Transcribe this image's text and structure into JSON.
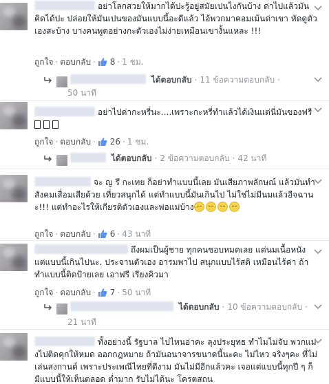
{
  "comments": [
    {
      "text": "อย่าโลกสวยให้มากได้ปะรู้อยู่สมัยเปนไงกันบ้าง ด่าไปแล้วมันคิดได้ปะ ปล่อยให้มันเปนของมันแบบนี้อะดีแล้ว ไอ้พวกมาคอมเม้นด่าเขา หัดดูตัวเองสะบ้าง บางคนพูดอย่างกะตัวเองไม่ง่ายเหมือนเขางั้นแหละ !!!",
      "like": "ถูกใจ",
      "reply": "ตอบกลับ",
      "likes": "8",
      "time": "1 ชม.",
      "reply_link": "ได้ตอบกลับ",
      "reply_count": "11 ข้อความตอบกลับ",
      "reply_time": "50 นาที"
    },
    {
      "text": "อย่าไปด่ากะหรี่นะ....เพราะกะหรี่ทำแล้วได้เงินแต่นี่มันของฟรี",
      "like": "ถูกใจ",
      "reply": "ตอบกลับ",
      "likes": "26",
      "time": "1 ชม.",
      "reply_link": "ได้ตอบกลับ",
      "reply_count": "2 ข้อความตอบกลับ",
      "reply_time": "42 นาที"
    },
    {
      "text": "จะ ญ รึ กะเทย ก็อย่าทำแบบนี้เลย มันเสียภาพลักษณ์ แล้วมันทำสังคมเสื่อมเสียด้วย เที่ยวสนุกได้ แต่ทำแบบนี้มันเกินไป ไม่ใช่ไม่มีนมแล้วอีจฉานะ!!! แต่ทำอะไรให้เกียรติตัวเองและพ่อแม่บ้าง",
      "like": "ถูกใจ",
      "reply": "ตอบกลับ",
      "likes": "6",
      "time": "43 นาที"
    },
    {
      "text": "ถึงผมเป็นผู้ชาย ทุกคนชอบหมดเลย แต่นมเนื้อหนัง แต่แบบนี้เกินไปนะ. ประจานตัวเอง อารมพาไป สนุกแบบไร้สติ เหมือนไร้ค่า ถ้าทำแบบนี้ติดป้ายเลย เอาฟรี เรียงคิวมา",
      "like": "ถูกใจ",
      "reply": "ตอบกลับ",
      "likes": "7",
      "time": "50 นาที",
      "reply_link": "ได้ตอบกลับ",
      "reply_count": "10 ข้อความตอบกลับ",
      "reply_time": "21 นาที"
    },
    {
      "text": "ทั้งอย่างนี้ รัฐบาล ไปไหนอ่าคะ ลุงประยุทธ ทำไมไม่จับ พวกแม่งไปติดคุกให้หมด ออกกฎหมาย ถ้ามันอนาจารขนาดนี้นะคะ ไม่ไหว จริงๆคะ ที่ไม่เล่นสงกานต์ เพราะประเพณีไทยที่ดีงาม มันไม่มีอีกแล้วคะ เจอแต่แบบนี้ทุกปี ๆ ก็มีแบบนี้ให้เห็นตลอด ต่ำมาก รับไม่ได้นะ โครตสถน"
    }
  ]
}
